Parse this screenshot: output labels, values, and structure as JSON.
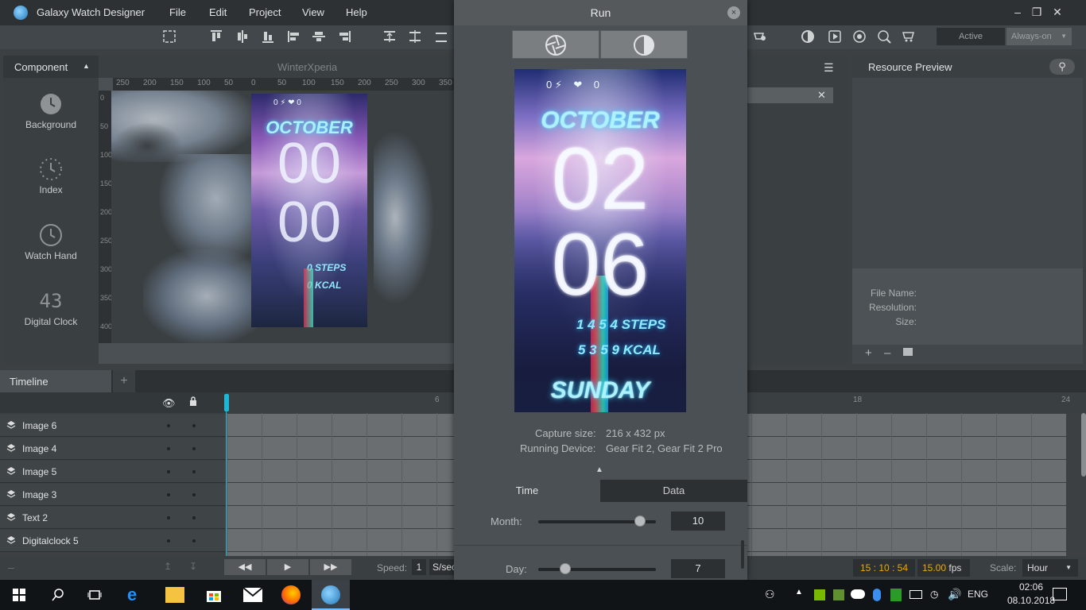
{
  "app": {
    "title": "Galaxy Watch Designer"
  },
  "menu": [
    "File",
    "Edit",
    "Project",
    "View",
    "Help"
  ],
  "component_panel": {
    "header": "Component",
    "items": [
      {
        "label": "Background",
        "icon": "clock-icon"
      },
      {
        "label": "Index",
        "icon": "index-icon"
      },
      {
        "label": "Watch Hand",
        "icon": "watch-hand-icon"
      },
      {
        "label": "Digital Clock",
        "icon": "digital-clock-icon",
        "glyph": "43"
      }
    ]
  },
  "canvas": {
    "project_name": "WinterXperia",
    "ruler_h": [
      "250",
      "200",
      "150",
      "100",
      "50",
      "0",
      "50",
      "100",
      "150",
      "200",
      "250",
      "300",
      "350"
    ],
    "ruler_v": [
      "0",
      "50",
      "100",
      "150",
      "200",
      "250",
      "300",
      "350",
      "400"
    ],
    "preview": {
      "month": "OCTOBER",
      "hour": "00",
      "minute": "00",
      "steps": "STEPS",
      "kcal": "KCAL",
      "steps_prefix": "0",
      "kcal_prefix": "0"
    }
  },
  "resource_panel": {
    "header": "Resource Preview",
    "fields": [
      {
        "label": "File Name:"
      },
      {
        "label": "Resolution:"
      },
      {
        "label": "Size:"
      }
    ]
  },
  "status": {
    "active_label": "Active",
    "always_on_label": "Always-on"
  },
  "run_dialog": {
    "title": "Run",
    "close": "×",
    "watch": {
      "month": "OCTOBER",
      "hour": "02",
      "minute": "06",
      "steps": "1 4 5 4 STEPS",
      "kcal": "5 3 5 9 KCAL",
      "day": "SUNDAY"
    },
    "capture_label": "Capture size:",
    "capture_value": "216 x 432 px",
    "device_label": "Running Device:",
    "device_value": "Gear Fit 2, Gear Fit 2 Pro",
    "tabs": [
      "Time",
      "Data"
    ],
    "sliders": [
      {
        "label": "Month:",
        "value": "10",
        "level": 0.9
      },
      {
        "label": "Day:",
        "value": "7",
        "level": 0.2
      }
    ]
  },
  "timeline": {
    "tab": "Timeline",
    "add": "+",
    "rows": [
      "Image 6",
      "Image 4",
      "Image 5",
      "Image 3",
      "Text 2",
      "Digitalclock 5"
    ],
    "ruler_marks": [
      "6",
      "18",
      "24"
    ],
    "speed_label": "Speed:",
    "speed_value": "1",
    "speed_unit": "S/sec",
    "time_display": "15 : 10 : 54",
    "fps_value": "15.00",
    "fps_unit": "fps",
    "scale_label": "Scale:",
    "scale_value": "Hour"
  },
  "taskbar": {
    "language": "ENG",
    "time": "02:06",
    "date": "08.10.2018"
  },
  "colors": {
    "accent_cyan": "#1fb6d6",
    "time_display": "#f0a800"
  }
}
